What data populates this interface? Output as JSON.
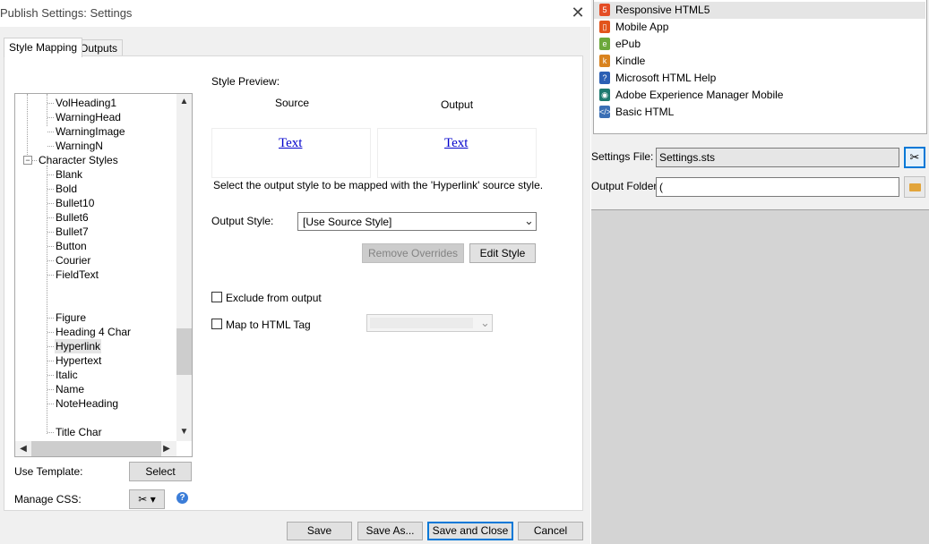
{
  "dialog": {
    "title": "Publish Settings: Settings",
    "close_glyph": "✕"
  },
  "tabs": [
    {
      "label": "Style Mapping",
      "active": true
    },
    {
      "label": "Outputs",
      "active": false
    }
  ],
  "tree": {
    "items": [
      "VolHeading1",
      "WarningHead",
      "WarningImage",
      "WarningN",
      "Character Styles",
      "Blank",
      "Bold",
      "Bullet10",
      "Bullet6",
      "Bullet7",
      "Button",
      "Courier",
      "FieldText",
      "",
      "",
      "Figure",
      "Heading 4 Char",
      "Hyperlink",
      "Hypertext",
      "Italic",
      "Name",
      "NoteHeading",
      "",
      "Title Char"
    ],
    "selected": "Hyperlink",
    "expander_glyph": "−"
  },
  "scroll": {
    "up": "▲",
    "down": "▼",
    "left": "◀",
    "right": "▶"
  },
  "template": {
    "label": "Use Template:",
    "button": "Select"
  },
  "css": {
    "label": "Manage CSS:",
    "tools_glyph": "✂",
    "dropdown_glyph": "▾",
    "help_glyph": "?"
  },
  "preview": {
    "heading": "Style Preview:",
    "source_label": "Source",
    "output_label": "Output",
    "source_text": "Text",
    "output_text": "Text",
    "instruction": "Select the output style to be mapped with the 'Hyperlink' source style."
  },
  "output_style": {
    "label": "Output Style:",
    "value": "[Use Source Style]",
    "chevron": "⌄"
  },
  "buttons": {
    "remove_overrides": "Remove Overrides",
    "edit_style": "Edit Style",
    "save": "Save",
    "save_as": "Save As...",
    "save_and_close": "Save and Close",
    "cancel": "Cancel"
  },
  "options": {
    "exclude_label": "Exclude from output",
    "exclude_checked": false,
    "map_label": "Map to HTML Tag",
    "map_checked": false,
    "map_value": ""
  },
  "outputs_list": [
    {
      "label": "Responsive HTML5",
      "icon": "html5-icon",
      "glyph": "5",
      "color": "#e44d26",
      "selected": true
    },
    {
      "label": "Mobile App",
      "icon": "mobile-app-icon",
      "glyph": "▯",
      "color": "#e2541b",
      "selected": false
    },
    {
      "label": "ePub",
      "icon": "epub-icon",
      "glyph": "e",
      "color": "#6ca83b",
      "selected": false
    },
    {
      "label": "Kindle",
      "icon": "kindle-icon",
      "glyph": "k",
      "color": "#d9831f",
      "selected": false
    },
    {
      "label": "Microsoft HTML Help",
      "icon": "html-help-icon",
      "glyph": "?",
      "color": "#2b5fb4",
      "selected": false
    },
    {
      "label": "Adobe Experience Manager Mobile",
      "icon": "aem-mobile-icon",
      "glyph": "◉",
      "color": "#1e7a70",
      "selected": false
    },
    {
      "label": "Basic HTML",
      "icon": "basic-html-icon",
      "glyph": "</>",
      "color": "#3a6fb5",
      "selected": false
    }
  ],
  "settings_file": {
    "label": "Settings File:",
    "value": "Settings.sts"
  },
  "output_folder": {
    "label": "Output Folder:",
    "value": "("
  },
  "colors": {
    "accent": "#0078d7",
    "selected_bg": "#e5e5e5",
    "panel_bg": "#f0f0f0",
    "link": "#0000cc"
  }
}
